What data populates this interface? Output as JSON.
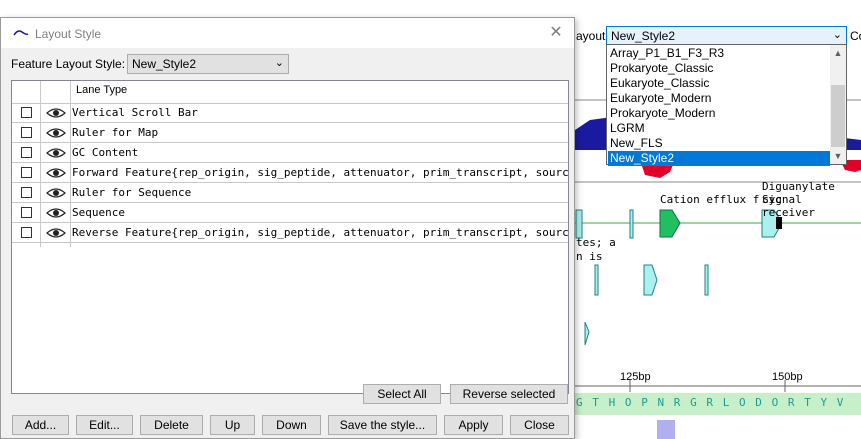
{
  "background": {
    "layout_label_fragment": "ayout:",
    "layout_combo_value": "New_Style2",
    "right_label_fragment": "Co",
    "dropdown_options": [
      "Array_P1_B1_F3_R3",
      "Prokaryote_Classic",
      "Eukaryote_Classic",
      "Eukaryote_Modern",
      "Prokaryote_Modern",
      "LGRM",
      "New_FLS",
      "New_Style2"
    ],
    "dropdown_selected": "New_Style2",
    "feature_labels": {
      "partial_top": "Diguanylate cyc",
      "cation": "Cation efflux f",
      "signal": "Signal receiver",
      "frag1": "tes; a",
      "frag2": "n is"
    },
    "ruler": {
      "tick1": "125bp",
      "tick2": "150bp"
    },
    "sequence_letters": [
      "G",
      "T",
      "H",
      "O",
      "P",
      "N",
      "R",
      "G",
      "R",
      "L",
      "O",
      "D",
      "O",
      "R",
      "T",
      "Y",
      "V"
    ]
  },
  "dialog": {
    "title": "Layout Style",
    "feature_layout_label": "Feature Layout Style:",
    "feature_layout_value": "New_Style2",
    "table": {
      "header": "Lane Type",
      "rows": [
        "Vertical Scroll Bar",
        "Ruler for Map",
        "GC Content",
        "Forward Feature{rep_origin, sig_peptide, attenuator, prim_transcript, source, v...",
        "Ruler for Sequence",
        "Sequence",
        "Reverse Feature{rep_origin, sig_peptide, attenuator, prim_transcript, source, v..."
      ]
    },
    "buttons": {
      "select_all": "Select All",
      "reverse_selected": "Reverse selected",
      "add": "Add...",
      "edit": "Edit...",
      "delete": "Delete",
      "up": "Up",
      "down": "Down",
      "save_style": "Save the style...",
      "apply": "Apply",
      "close": "Close"
    }
  },
  "colors": {
    "accent": "#0078d7",
    "combo_bg": "#e5f1fb",
    "gc_blue": "#1a1aa0",
    "gc_red": "#e0002a",
    "feature_green": "#20c060",
    "feature_cyan": "#aaf0f0",
    "sequence_band": "#c8f0c8"
  }
}
